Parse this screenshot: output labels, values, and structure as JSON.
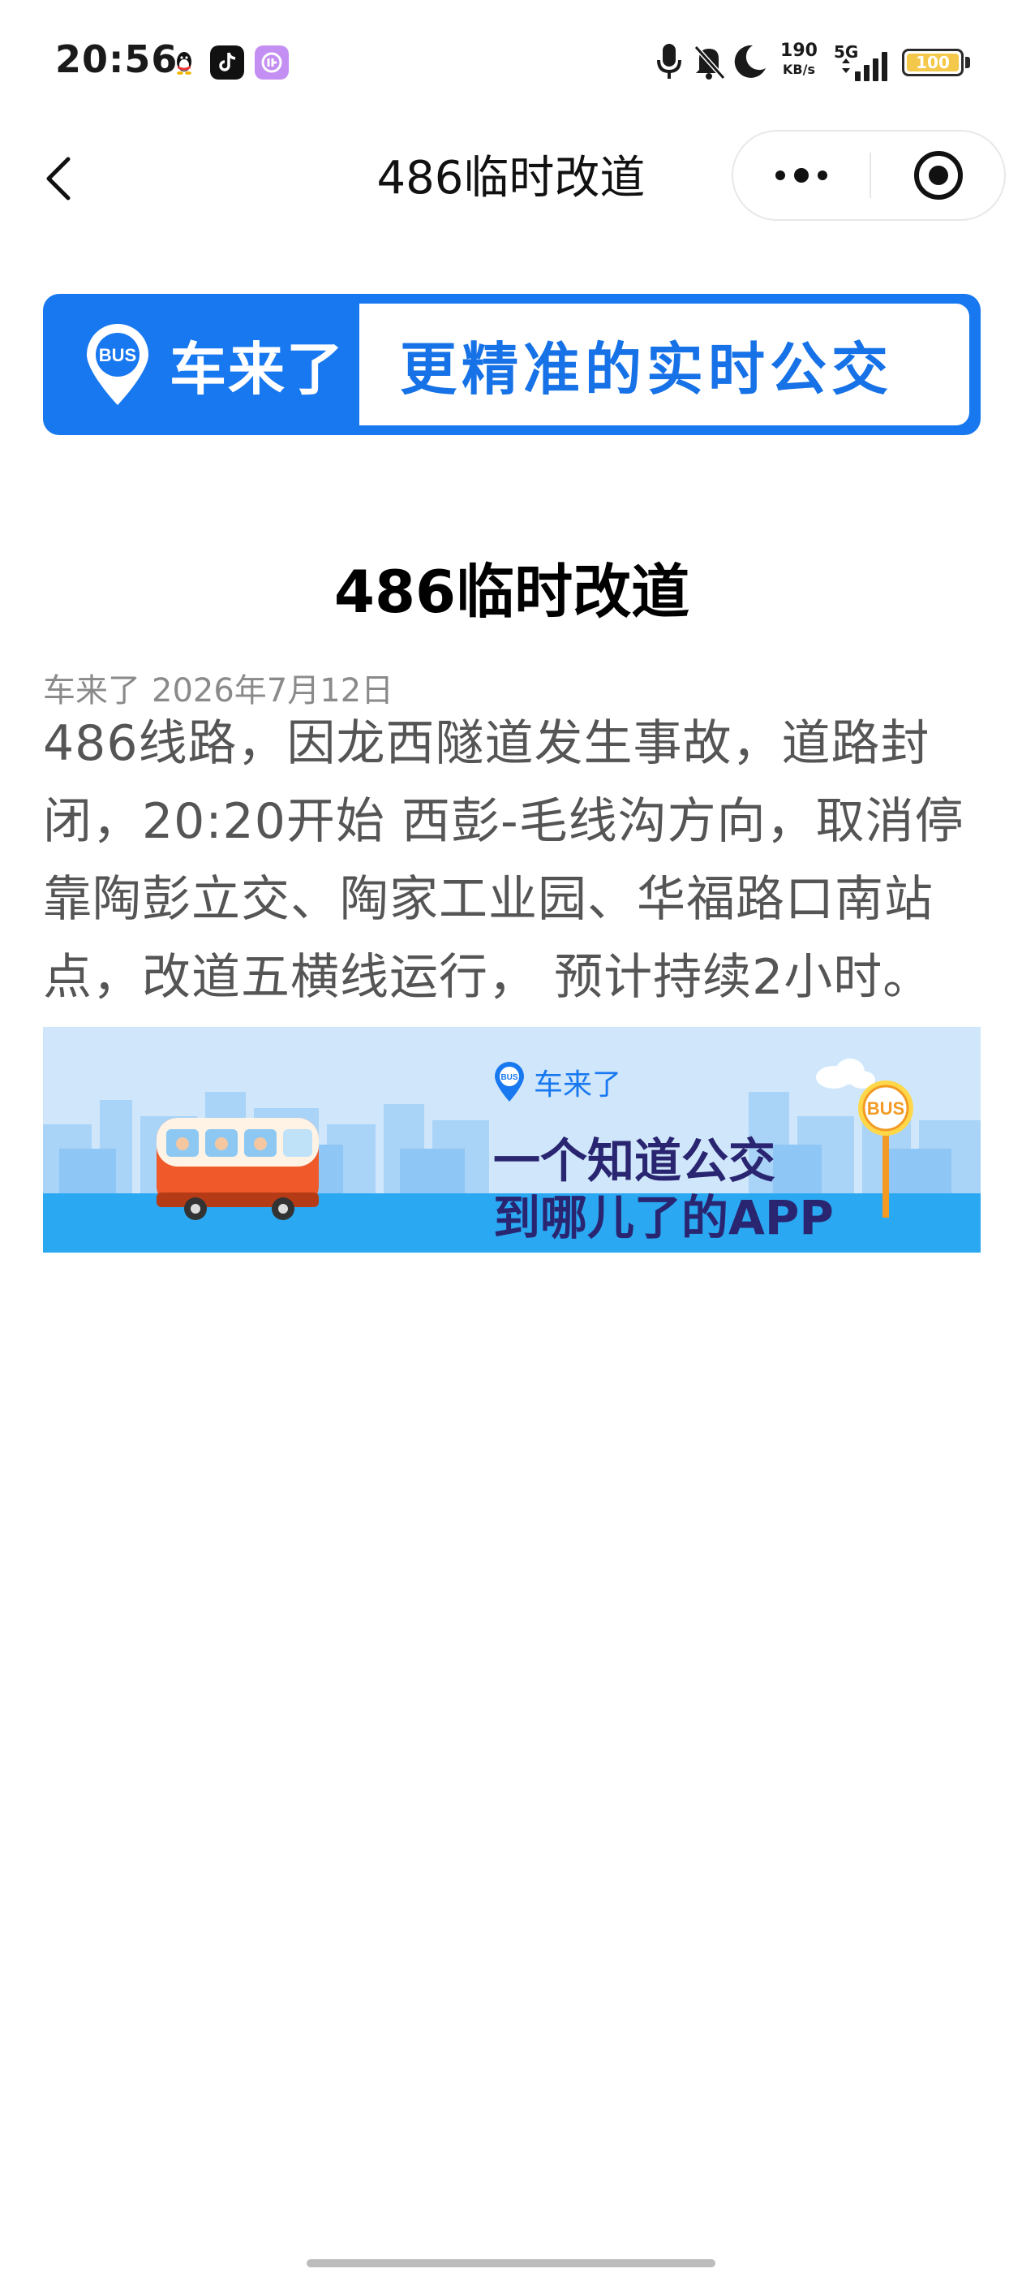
{
  "status_bar": {
    "time": "20:56",
    "net_speed_value": "190",
    "net_speed_unit": "KB/s",
    "network_type": "5G",
    "battery_level": "100",
    "icons": [
      "qq-icon",
      "tiktok-icon",
      "app-icon",
      "mic-icon",
      "bell-muted-icon",
      "moon-icon",
      "signal-icon",
      "battery-icon"
    ]
  },
  "nav": {
    "title": "486临时改道"
  },
  "top_banner": {
    "brand_badge": "BUS",
    "brand_name": "车来了",
    "slogan": "更精准的实时公交",
    "colors": {
      "primary": "#1878f0",
      "text": "#1672e6"
    }
  },
  "article": {
    "title": "486临时改道",
    "source": "车来了",
    "date": "2026年7月12日",
    "content": "486线路，因龙西隧道发生事故，道路封闭，20:20开始 西彭-毛线沟方向，取消停靠陶彭立交、陶家工业园、华福路口南站点，改道五横线运行， 预计持续2小时。"
  },
  "bottom_banner": {
    "logo_badge": "BUS",
    "logo_text": "车来了",
    "line1": "一个知道公交",
    "line2": "到哪儿了的APP",
    "stop_sign": "BUS",
    "colors": {
      "sky": "#cfe6fb",
      "road": "#2aa8f2",
      "bus": "#f0592a"
    }
  }
}
